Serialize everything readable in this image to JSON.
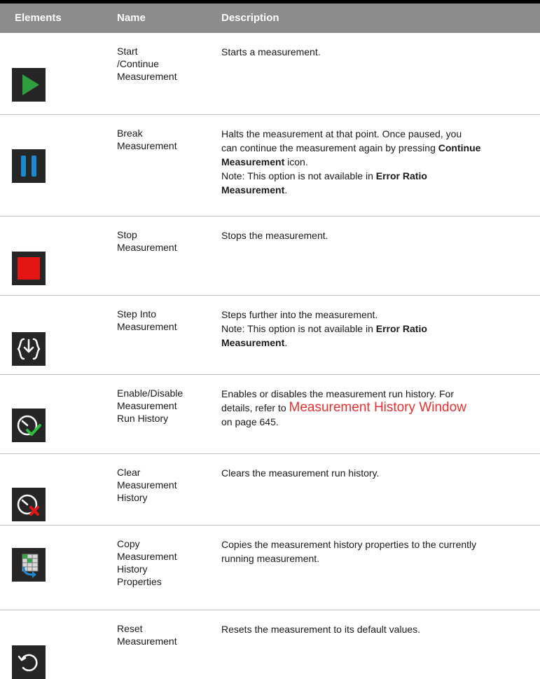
{
  "header": {
    "col_elements": "Elements",
    "col_name": "Name",
    "col_description": "Description"
  },
  "rows": [
    {
      "name_lines": [
        "Start",
        "/Continue",
        "Measurement"
      ],
      "icon": "play-icon",
      "desc": [
        [
          {
            "t": "Starts a measurement."
          }
        ]
      ]
    },
    {
      "name_lines": [
        "Break",
        "Measurement"
      ],
      "icon": "pause-icon",
      "desc": [
        [
          {
            "t": "Halts the measurement at that point. Once paused, you"
          }
        ],
        [
          {
            "t": "can continue the measurement again by pressing "
          },
          {
            "t": "Continue",
            "b": true
          }
        ],
        [
          {
            "t": "Measurement",
            "b": true
          },
          {
            "t": " icon."
          }
        ],
        [
          {
            "t": "Note: This option is not available in "
          },
          {
            "t": "Error Ratio",
            "b": true
          }
        ],
        [
          {
            "t": "Measurement",
            "b": true
          },
          {
            "t": "."
          }
        ]
      ]
    },
    {
      "name_lines": [
        "Stop",
        "Measurement"
      ],
      "icon": "stop-icon",
      "desc": [
        [
          {
            "t": "Stops the measurement."
          }
        ]
      ]
    },
    {
      "name_lines": [
        "Step Into",
        "Measurement"
      ],
      "icon": "step-into-icon",
      "desc": [
        [
          {
            "t": "Steps further into the measurement."
          }
        ],
        [
          {
            "t": "Note: This option is not available in "
          },
          {
            "t": "Error Ratio",
            "b": true
          }
        ],
        [
          {
            "t": "Measurement",
            "b": true
          },
          {
            "t": "."
          }
        ]
      ]
    },
    {
      "name_lines": [
        "Enable/Disable",
        "Measurement",
        "Run History"
      ],
      "icon": "history-enable-icon",
      "desc": [
        [
          {
            "t": "Enables or disables the measurement run history. For"
          }
        ],
        [
          {
            "t": "details, refer to "
          },
          {
            "t": "Measurement History Window",
            "link": true
          }
        ],
        [
          {
            "t": "on page 645."
          }
        ]
      ]
    },
    {
      "name_lines": [
        "Clear",
        "Measurement",
        "History"
      ],
      "icon": "history-clear-icon",
      "desc": [
        [
          {
            "t": "Clears the measurement run history."
          }
        ]
      ]
    },
    {
      "name_lines": [
        "Copy",
        "Measurement",
        "History",
        "Properties"
      ],
      "icon": "copy-properties-icon",
      "desc": [
        [
          {
            "t": "Copies the measurement history properties to the currently"
          }
        ],
        [
          {
            "t": "running measurement."
          }
        ]
      ]
    },
    {
      "name_lines": [
        "Reset",
        "Measurement"
      ],
      "icon": "reset-icon",
      "desc": [
        [
          {
            "t": "Resets the measurement to its default values."
          }
        ]
      ]
    }
  ]
}
